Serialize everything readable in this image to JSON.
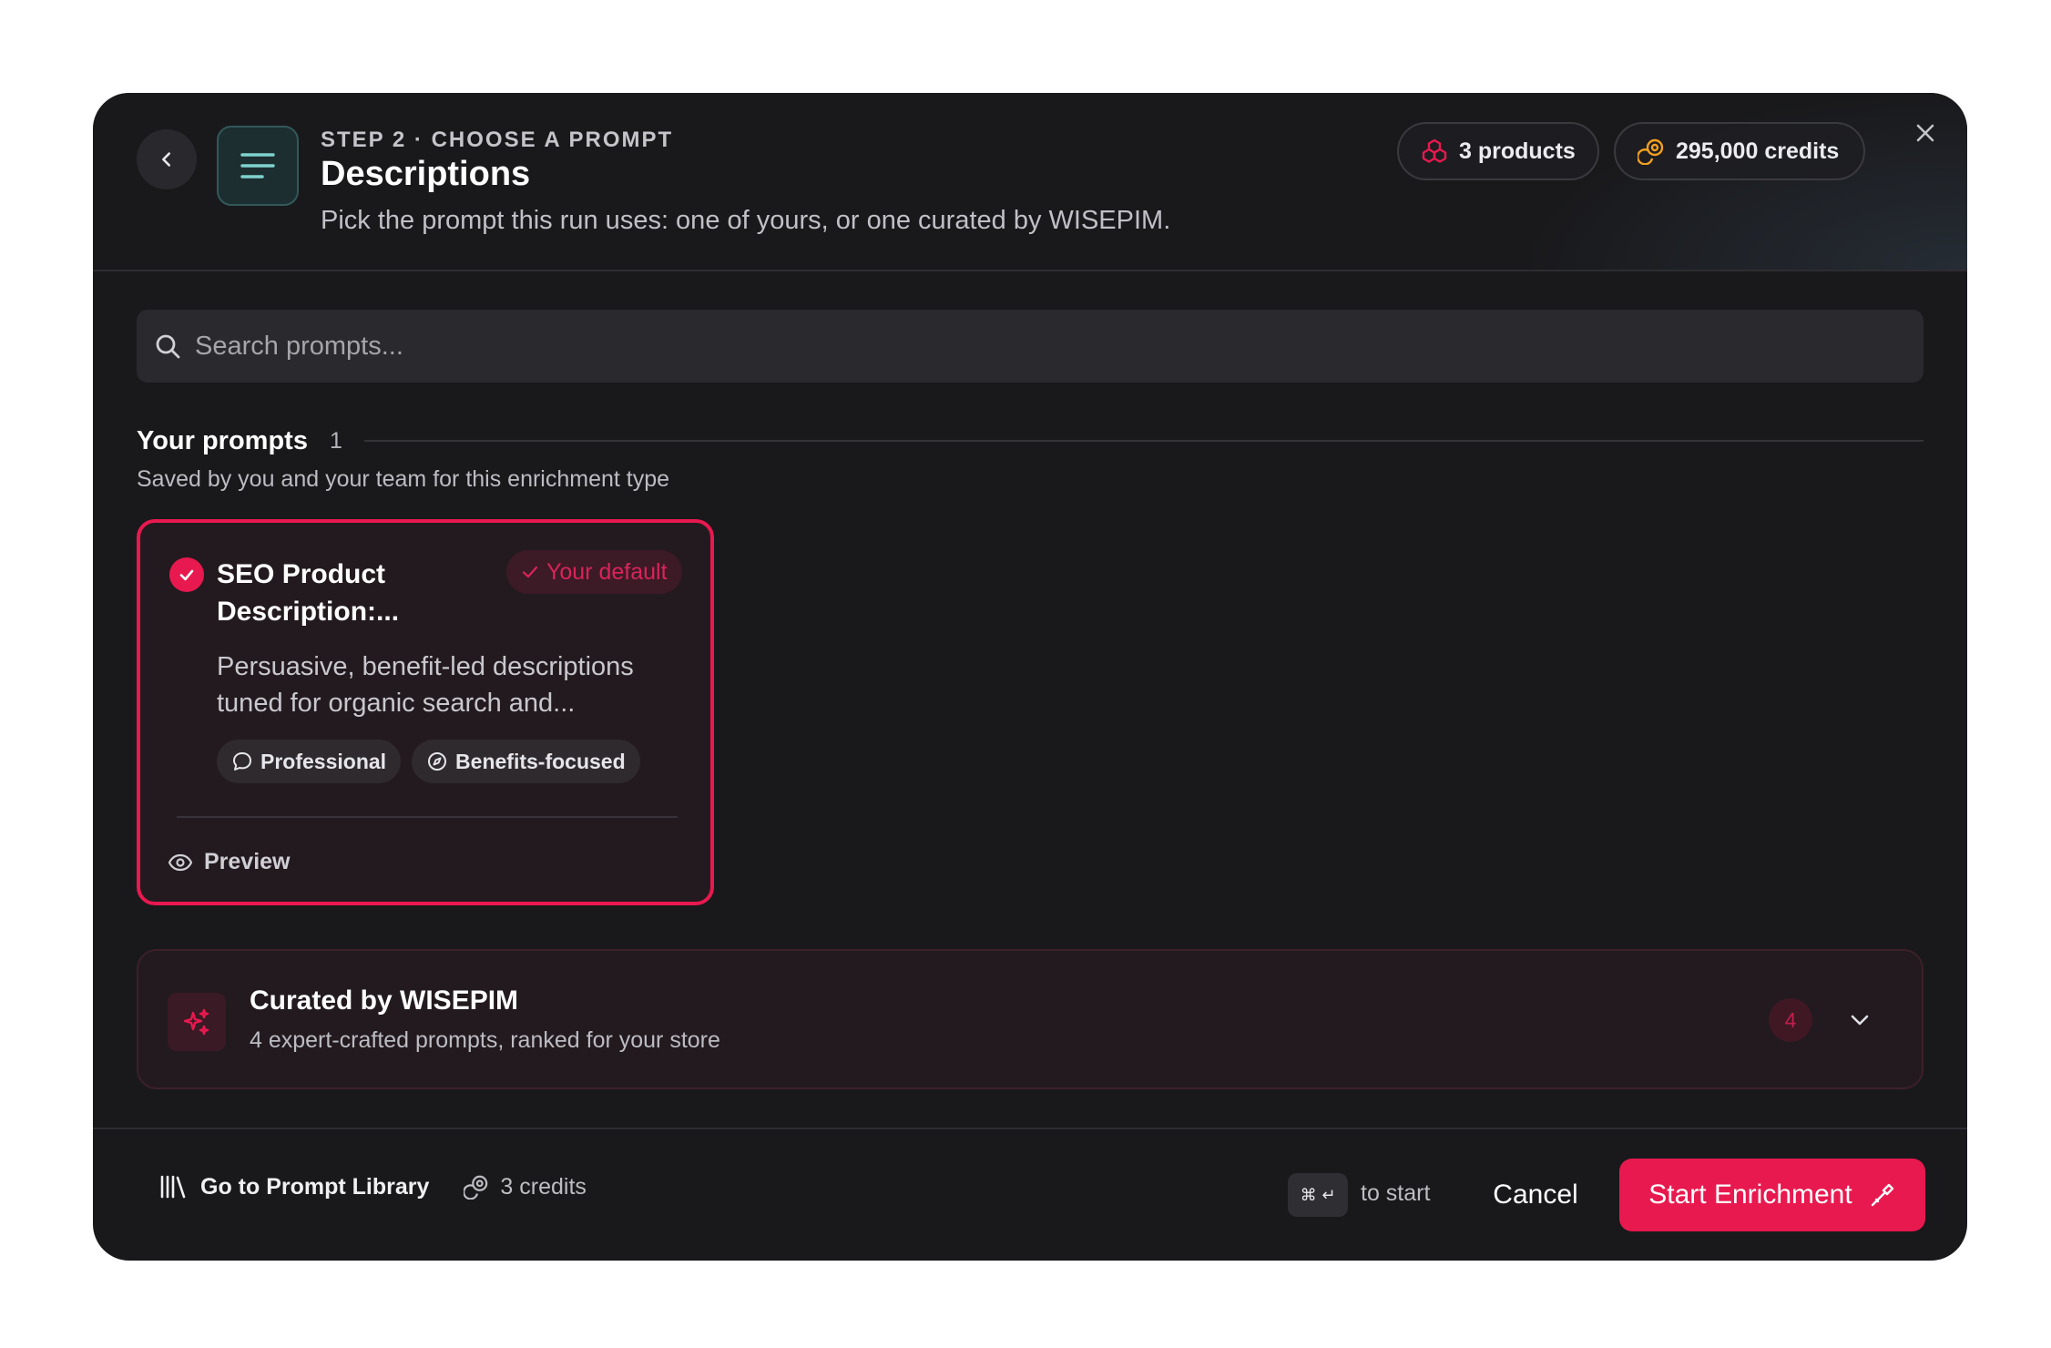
{
  "header": {
    "step_label": "STEP 2 · CHOOSE A PROMPT",
    "title": "Descriptions",
    "subtitle": "Pick the prompt this run uses: one of yours, or one curated by WISEPIM.",
    "products_label": "3 products",
    "credits_label": "295,000 credits"
  },
  "search": {
    "placeholder": "Search prompts..."
  },
  "your_prompts": {
    "title": "Your prompts",
    "count": "1",
    "subtitle": "Saved by you and your team for this enrichment type",
    "card": {
      "title": "SEO Product Description:...",
      "badge": "Your default",
      "description": "Persuasive, benefit-led descriptions tuned for organic search and...",
      "tags": [
        "Professional",
        "Benefits-focused"
      ],
      "preview_label": "Preview",
      "selected": true
    }
  },
  "curated": {
    "title": "Curated by WISEPIM",
    "subtitle": "4 expert-crafted prompts, ranked for your store",
    "count": "4"
  },
  "footer": {
    "library_label": "Go to Prompt Library",
    "credits_cost": "3 credits",
    "shortcut_symbols": "⌘ ↵",
    "shortcut_hint": "to start",
    "cancel_label": "Cancel",
    "start_label": "Start Enrichment"
  },
  "colors": {
    "accent": "#e8194f",
    "background": "#19191c",
    "credits_icon": "#f0a020",
    "type_icon": "#7fd3cf"
  },
  "icons": {
    "back": "chevron-left-icon",
    "type": "text-lines-icon",
    "products": "boxes-icon",
    "credits": "coins-icon",
    "close": "close-icon",
    "search": "search-icon",
    "selected": "check-circle-icon",
    "tag_professional": "speech-bubble-icon",
    "tag_benefits": "compass-icon",
    "preview": "eye-icon",
    "curated": "sparkles-icon",
    "expand": "chevron-down-icon",
    "library": "library-icon",
    "start": "magic-wand-icon"
  }
}
